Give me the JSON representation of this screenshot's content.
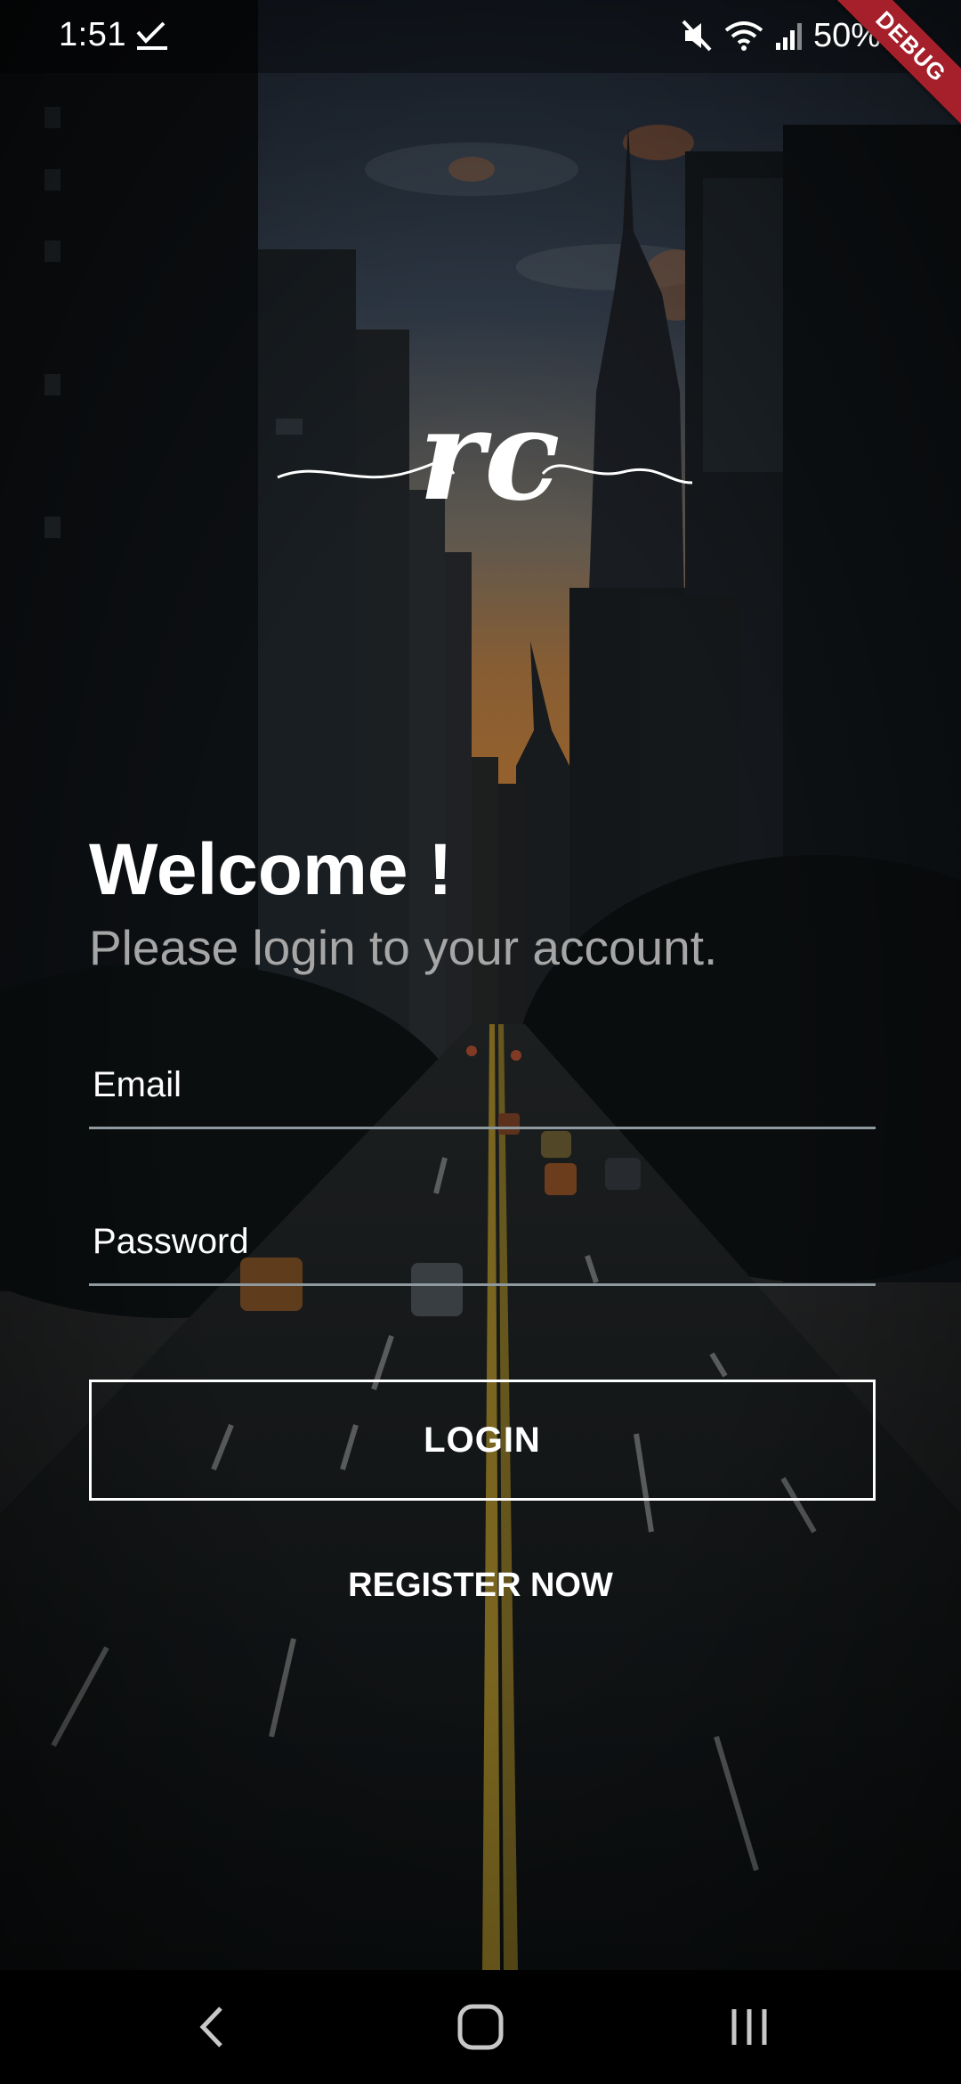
{
  "status_bar": {
    "time": "1:51",
    "battery": "50%",
    "icons": [
      "download-complete-icon",
      "mute-icon",
      "wifi-icon",
      "signal-icon",
      "battery-icon"
    ]
  },
  "debug_banner": "DEBUG",
  "logo": {
    "text": "rc"
  },
  "welcome": {
    "title": "Welcome !",
    "subtitle": "Please login to your account."
  },
  "form": {
    "email_label": "Email",
    "password_label": "Password",
    "login_label": "LOGIN",
    "register_label": "REGISTER NOW"
  },
  "nav_bar": {
    "icons": [
      "back-icon",
      "home-icon",
      "recents-icon"
    ]
  },
  "colors": {
    "text": "#ffffff",
    "subtitle": "#a6a6a6",
    "underline": "#8f9aa0",
    "debug_banner": "#a5202b",
    "sunset": "#e08a3c"
  }
}
